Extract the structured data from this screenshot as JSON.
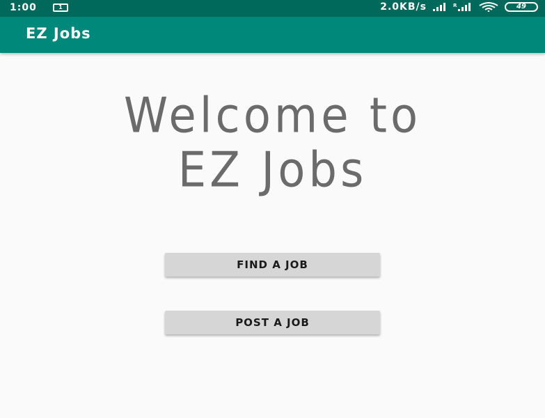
{
  "status_bar": {
    "time": "1:00",
    "notification_badge": "1",
    "network_speed": "2.0KB/s",
    "battery_level": "49"
  },
  "app_bar": {
    "title": "EZ Jobs",
    "color": "#00897b"
  },
  "main": {
    "welcome_line1": "Welcome to",
    "welcome_line2": "EZ Jobs",
    "find_job_label": "FIND A JOB",
    "post_job_label": "POST A JOB"
  },
  "colors": {
    "status_bar": "#00695c",
    "app_bar": "#00897b",
    "background": "#fafafa",
    "button": "#d6d6d6",
    "welcome_text": "#6b6b6b"
  }
}
